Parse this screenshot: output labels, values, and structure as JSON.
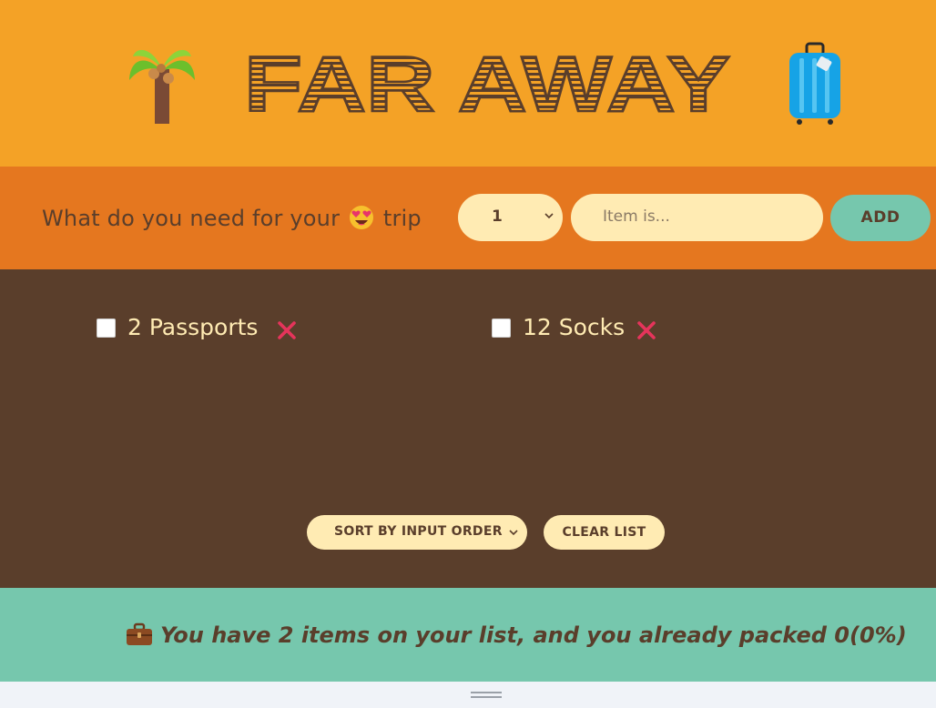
{
  "header": {
    "title": "FAR AWAY",
    "palm_icon": "palm-tree-icon",
    "suitcase_icon": "luggage-icon"
  },
  "form": {
    "question_prefix": "What do you need for your",
    "question_suffix": "trip",
    "emoji": "heart-eyes-emoji",
    "quantity_value": "1",
    "item_placeholder": "Item is...",
    "add_label": "ADD"
  },
  "list": {
    "items": [
      {
        "label": "2 Passports",
        "packed": false
      },
      {
        "label": "12 Socks",
        "packed": false
      }
    ]
  },
  "actions": {
    "sort_value": "SORT BY INPUT ORDER",
    "clear_label": "CLEAR LIST"
  },
  "stats": {
    "text": "You have 2 items on your list, and you already packed 0(0%)",
    "icon": "briefcase-icon"
  },
  "colors": {
    "header_bg": "#f4a226",
    "form_bg": "#e5771f",
    "list_bg": "#5a3e2b",
    "stats_bg": "#76c7ad",
    "cream": "#ffebb3",
    "brown": "#5a3e2b",
    "delete_red": "#e5345b"
  }
}
